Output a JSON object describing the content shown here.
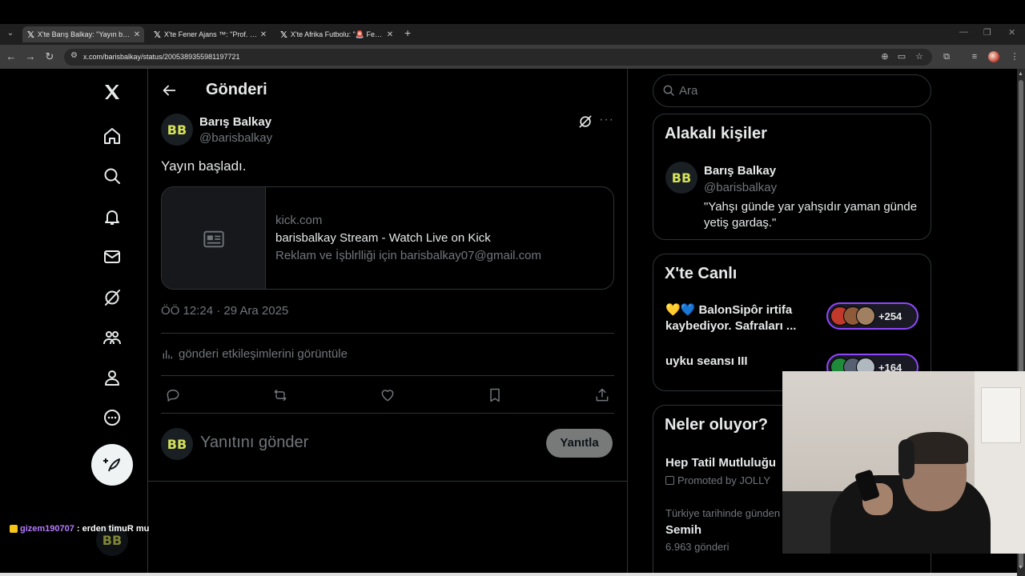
{
  "browser": {
    "tabs": [
      {
        "title": "X'te Barış Balkay: \"Yayın başladı.",
        "active": true
      },
      {
        "title": "X'te Fener Ajans ™: \"Prof. Dr. Se",
        "active": false
      },
      {
        "title": "X'te Afrika Futbolu: \"🚨 Fenerb",
        "active": false
      }
    ],
    "url": "x.com/barisbalkay/status/2005389355981197721"
  },
  "post_header": {
    "title": "Gönderi"
  },
  "tweet": {
    "author_name": "Barış Balkay",
    "author_handle": "@barisbalkay",
    "avatar_text": "BB",
    "text": "Yayın başladı.",
    "card": {
      "domain": "kick.com",
      "title": "barisbalkay Stream - Watch Live on Kick",
      "description": "Reklam ve İşblrlliği için barisbalkay07@gmail.com"
    },
    "timestamp": "ÖÖ 12:24 · 29 Ara 2025",
    "analytics_label": "gönderi etkileşimlerini görüntüle"
  },
  "reply": {
    "placeholder": "Yanıtını gönder",
    "button": "Yanıtla"
  },
  "sidebar": {
    "search_placeholder": "Ara",
    "related": {
      "title": "Alakalı kişiler",
      "name": "Barış Balkay",
      "handle": "@barisbalkay",
      "bio": "\"Yahşı günde yar yahşıdır yaman günde yetiş gardaş.\""
    },
    "live": {
      "title": "X'te Canlı",
      "items": [
        {
          "title": "💛💙 BalonSipôr irtifa kaybediyor. Safraları ...",
          "count": "+254"
        },
        {
          "title": "uyku seansı III",
          "count": "+164"
        }
      ]
    },
    "trends": {
      "title": "Neler oluyor?",
      "promoted_name": "Hep Tatil Mutluluğu",
      "promoted_by": "Promoted by JOLLY",
      "trend_meta": "Türkiye tarihinde günden",
      "trend_name": "Semih",
      "trend_count": "6.963 gönderi"
    }
  },
  "chat": {
    "user": "gizem190707",
    "message": ": erden timuR mu"
  },
  "colors": {
    "accent": "#1d9bf0",
    "live_ring": "#9146ff",
    "avatar_text": "#d4e157"
  }
}
